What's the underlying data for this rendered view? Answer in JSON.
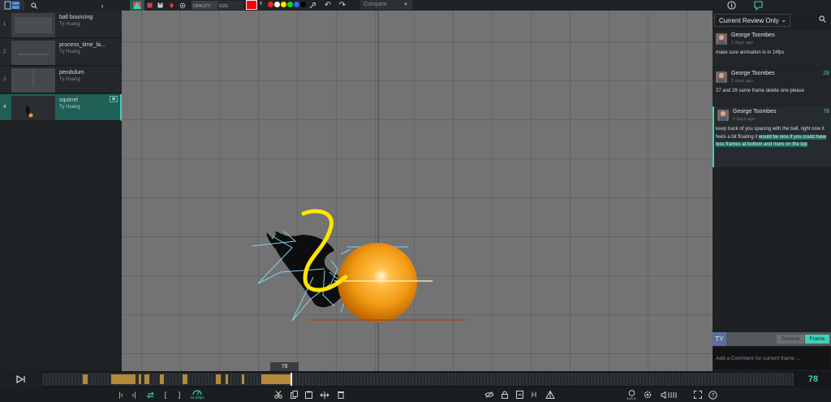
{
  "toolbar": {
    "opacity_label": "OPACITY",
    "size_label": "SIZE",
    "compare_placeholder": "Compare",
    "palette": [
      "#ff2020",
      "#ffffff",
      "#ffe600",
      "#25d025",
      "#2b6bff",
      "#000000"
    ],
    "active_color": "#ff0000"
  },
  "shots": [
    {
      "num": "1",
      "title": "ball bouncing",
      "author": "Ty Huang",
      "active": false
    },
    {
      "num": "2",
      "title": "process_time_la...",
      "author": "Ty Huang",
      "active": false
    },
    {
      "num": "3",
      "title": "pendulum",
      "author": "Ty Huang",
      "active": false
    },
    {
      "num": "4",
      "title": "squirrel",
      "author": "Ty Huang",
      "active": true
    }
  ],
  "review": {
    "filter_label": "Current Review Only",
    "comments": [
      {
        "name": "George Toombes",
        "time": "2 days ago",
        "frame": "",
        "text": "make sure animation is in 24fps"
      },
      {
        "name": "George Toombes",
        "time": "2 days ago",
        "frame": "28",
        "text": "27 and 28 same frame delete one please"
      },
      {
        "name": "George Toombes",
        "time": "2 days ago",
        "frame": "78",
        "text_plain": "keep track of you spacing with the ball, right now it feels a bit floating it ",
        "text_highlight": "would be nice if you could have less frames at bottom and more on the top"
      }
    ]
  },
  "compose": {
    "user_initials": "TY",
    "tab_general": "General",
    "tab_frame": "Frame",
    "placeholder": "Add a Comment for current frame ..."
  },
  "timeline": {
    "current_frame": "78",
    "playhead_badge": "78"
  },
  "bottombar": {
    "fps_label": "24.00fps",
    "zoom_label": "1x/1.0",
    "h_label": "H"
  }
}
